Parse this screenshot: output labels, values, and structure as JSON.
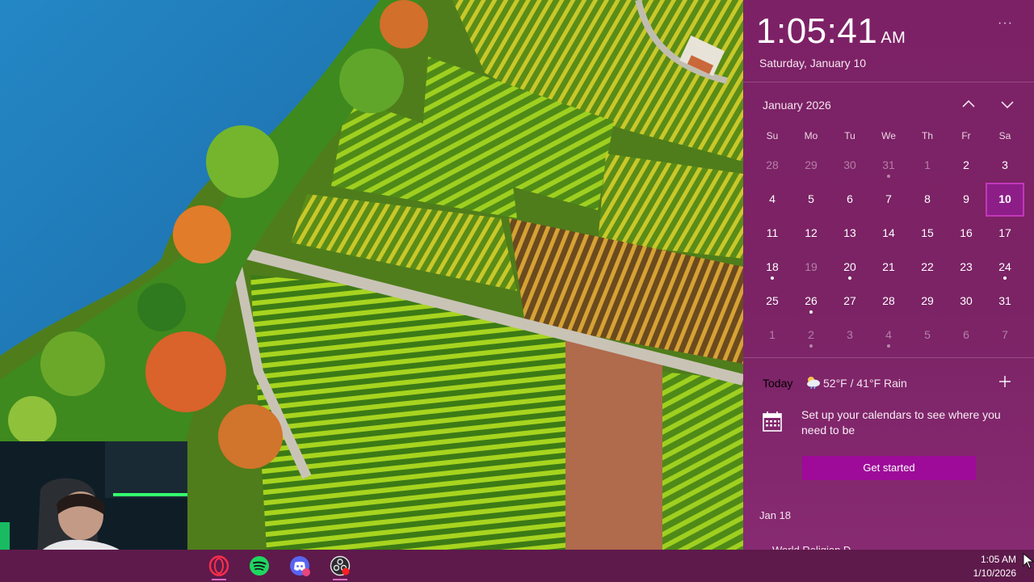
{
  "clock": {
    "time": "1:05:41",
    "ampm": "AM",
    "date": "Saturday, January 10",
    "more_label": "···"
  },
  "calendar": {
    "month_label": "January 2026",
    "weekdays": [
      "Su",
      "Mo",
      "Tu",
      "We",
      "Th",
      "Fr",
      "Sa"
    ],
    "weeks": [
      [
        {
          "d": "28",
          "out": true
        },
        {
          "d": "29",
          "out": true
        },
        {
          "d": "30",
          "out": true
        },
        {
          "d": "31",
          "out": true,
          "dot": true
        },
        {
          "d": "1",
          "out": true
        },
        {
          "d": "2"
        },
        {
          "d": "3"
        }
      ],
      [
        {
          "d": "4"
        },
        {
          "d": "5"
        },
        {
          "d": "6"
        },
        {
          "d": "7"
        },
        {
          "d": "8"
        },
        {
          "d": "9"
        },
        {
          "d": "10",
          "today": true
        }
      ],
      [
        {
          "d": "11"
        },
        {
          "d": "12"
        },
        {
          "d": "13"
        },
        {
          "d": "14"
        },
        {
          "d": "15"
        },
        {
          "d": "16"
        },
        {
          "d": "17"
        }
      ],
      [
        {
          "d": "18",
          "dot": true
        },
        {
          "d": "19",
          "out": true
        },
        {
          "d": "20",
          "dot": true
        },
        {
          "d": "21"
        },
        {
          "d": "22"
        },
        {
          "d": "23"
        },
        {
          "d": "24",
          "dot": true
        }
      ],
      [
        {
          "d": "25"
        },
        {
          "d": "26",
          "dot": true
        },
        {
          "d": "27"
        },
        {
          "d": "28"
        },
        {
          "d": "29"
        },
        {
          "d": "30"
        },
        {
          "d": "31"
        }
      ],
      [
        {
          "d": "1",
          "out": true
        },
        {
          "d": "2",
          "out": true,
          "dot": true
        },
        {
          "d": "3",
          "out": true
        },
        {
          "d": "4",
          "out": true,
          "dot": true
        },
        {
          "d": "5",
          "out": true
        },
        {
          "d": "6",
          "out": true
        },
        {
          "d": "7",
          "out": true
        }
      ]
    ]
  },
  "agenda": {
    "today_label": "Today",
    "weather": "52°F / 41°F Rain",
    "setup_text": "Set up your calendars to see where you need to be",
    "get_started": "Get started",
    "next_date": "Jan 18",
    "next_event_partial": "World Religion D..."
  },
  "taskbar": {
    "apps": [
      {
        "name": "opera-icon",
        "active": true
      },
      {
        "name": "spotify-icon",
        "active": false
      },
      {
        "name": "discord-icon",
        "active": false
      },
      {
        "name": "obs-icon",
        "active": true
      }
    ],
    "tray_time": "1:05 AM",
    "tray_date": "1/10/2026"
  },
  "colors": {
    "accent": "#9d0b98",
    "flyout_bg": "#7d2166",
    "taskbar_bg": "#5e1a4b"
  }
}
